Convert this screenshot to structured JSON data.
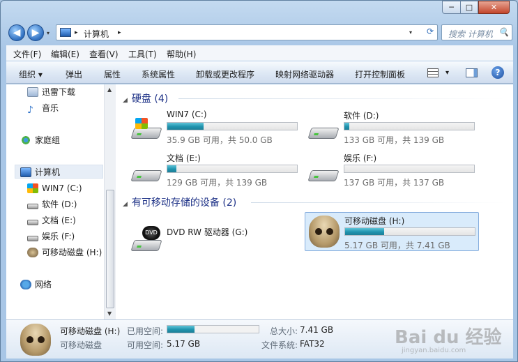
{
  "window": {
    "min": "─",
    "max": "□",
    "close": "✕"
  },
  "nav": {
    "back": "◀",
    "forward": "▶",
    "history": "▾"
  },
  "address": {
    "separator1": "▸",
    "location": "计算机",
    "separator2": "▸",
    "drop": "▾",
    "refresh": "⟳"
  },
  "search": {
    "placeholder": "搜索 计算机",
    "icon": "🔍"
  },
  "menu": [
    "文件(F)",
    "编辑(E)",
    "查看(V)",
    "工具(T)",
    "帮助(H)"
  ],
  "toolbar": {
    "organize": "组织 ▾",
    "eject": "弹出",
    "properties": "属性",
    "system_properties": "系统属性",
    "uninstall": "卸载或更改程序",
    "map_drive": "映射网络驱动器",
    "control_panel": "打开控制面板",
    "view_drop": "▾",
    "help": "?"
  },
  "sidebar": {
    "items": [
      {
        "label": "迅雷下载"
      },
      {
        "label": "音乐"
      },
      {
        "label": "家庭组"
      },
      {
        "label": "计算机"
      },
      {
        "label": "WIN7 (C:)"
      },
      {
        "label": "软件 (D:)"
      },
      {
        "label": "文档 (E:)"
      },
      {
        "label": "娱乐 (F:)"
      },
      {
        "label": "可移动磁盘 (H:)"
      },
      {
        "label": "网络"
      }
    ]
  },
  "groups": {
    "hdd": "硬盘 (4)",
    "removable": "有可移动存储的设备 (2)"
  },
  "drives": [
    {
      "name": "WIN7 (C:)",
      "info": "35.9 GB 可用，共 50.0 GB",
      "used": 0.28
    },
    {
      "name": "软件 (D:)",
      "info": "133 GB 可用，共 139 GB",
      "used": 0.04
    },
    {
      "name": "文档 (E:)",
      "info": "129 GB 可用，共 139 GB",
      "used": 0.07
    },
    {
      "name": "娱乐 (F:)",
      "info": "137 GB 可用，共 137 GB",
      "used": 0.0
    },
    {
      "name": "DVD RW 驱动器 (G:)"
    },
    {
      "name": "可移动磁盘 (H:)",
      "info": "5.17 GB 可用，共 7.41 GB",
      "used": 0.3
    }
  ],
  "icons": {
    "dvd_label": "DVD"
  },
  "status": {
    "name": "可移动磁盘 (H:)",
    "type": "可移动磁盘",
    "used_label": "已用空间:",
    "free_label": "可用空间:",
    "free_value": "5.17 GB",
    "total_label": "总大小:",
    "total_value": "7.41 GB",
    "fs_label": "文件系统:",
    "fs_value": "FAT32",
    "used": 0.3
  },
  "watermark": {
    "text": "Bai du 经验",
    "sub": "jingyan.baidu.com"
  },
  "colors": {
    "accent": "#1e3287",
    "bar_fill": "#1f93ae",
    "selection": "#d9ebfb"
  }
}
